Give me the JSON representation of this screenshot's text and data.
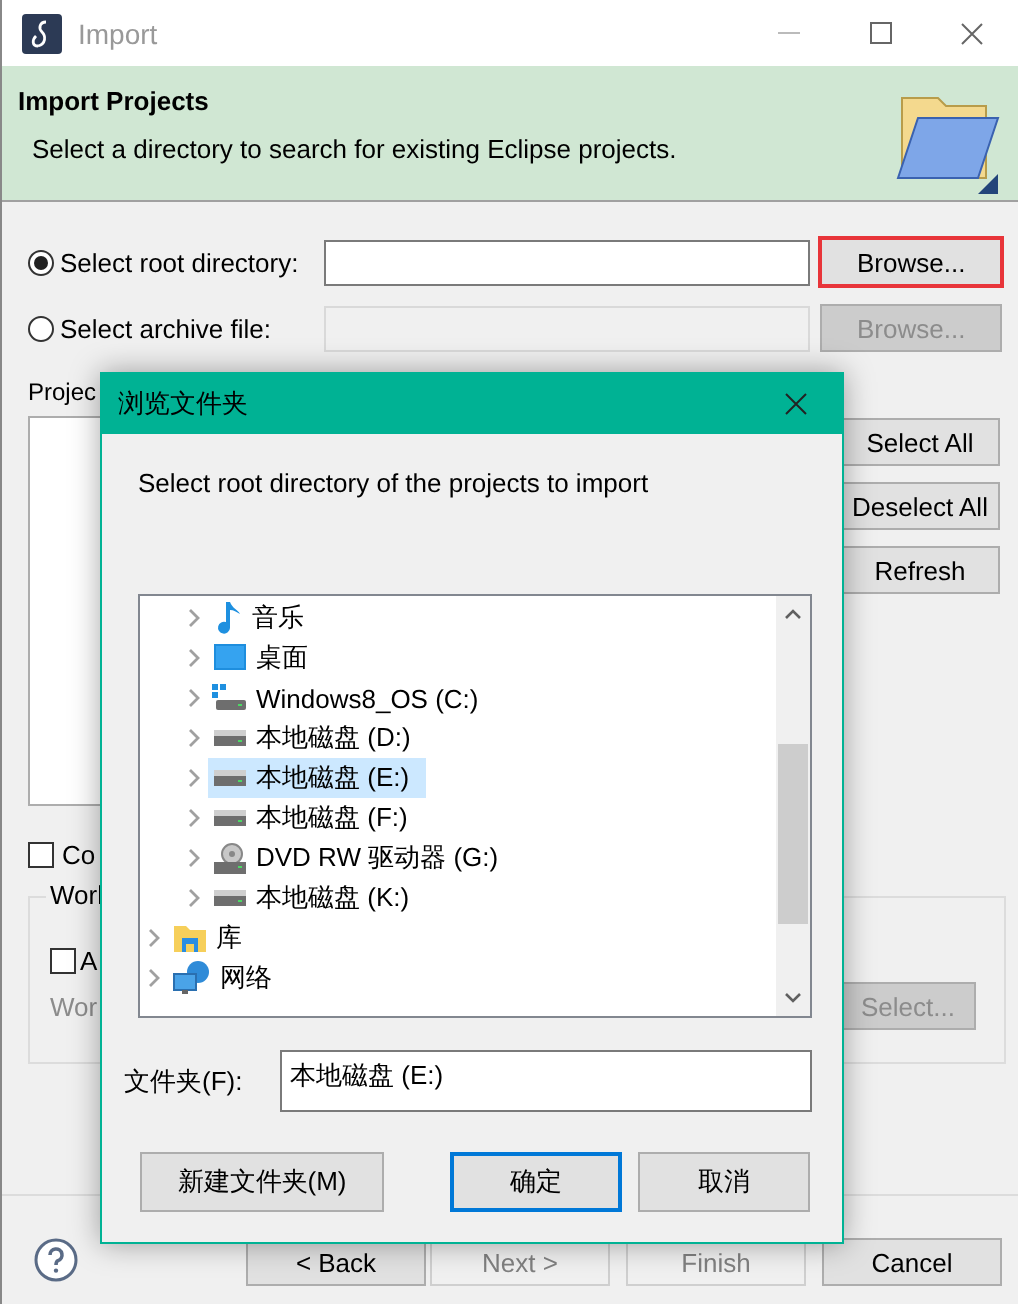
{
  "window": {
    "title": "Import"
  },
  "header": {
    "title": "Import Projects",
    "subtitle": "Select a directory to search for existing Eclipse projects."
  },
  "source": [
    {
      "label": "Select root directory:",
      "selected": true,
      "disabled": false,
      "button": "Browse...",
      "highlighted": true
    },
    {
      "label": "Select archive file:",
      "selected": false,
      "disabled": true,
      "button": "Browse...",
      "highlighted": false
    }
  ],
  "projects": {
    "label": "Projec",
    "buttons": [
      "Select All",
      "Deselect All",
      "Refresh"
    ]
  },
  "options": [
    {
      "label": "Co",
      "checked": false
    }
  ],
  "working_sets": {
    "label": "Worl",
    "checkbox": {
      "label": "A",
      "checked": false
    },
    "field_label": "Wor",
    "field_disabled": true,
    "button": "Select...",
    "button_disabled": true
  },
  "footer": {
    "buttons": [
      {
        "label": "< Back",
        "disabled": false
      },
      {
        "label": "Next >",
        "disabled": true
      },
      {
        "label": "Finish",
        "disabled": true
      },
      {
        "label": "Cancel",
        "disabled": false
      }
    ]
  },
  "folder_dialog": {
    "title": "浏览文件夹",
    "prompt": "Select root directory of the projects to import",
    "tree": {
      "nested_items": [
        {
          "kind": "music",
          "label": "音乐",
          "selected": false
        },
        {
          "kind": "desktop",
          "label": "桌面",
          "selected": false
        },
        {
          "kind": "system-drive",
          "label": "Windows8_OS (C:)",
          "selected": false
        },
        {
          "kind": "drive",
          "label": "本地磁盘 (D:)",
          "selected": false
        },
        {
          "kind": "drive",
          "label": "本地磁盘 (E:)",
          "selected": true
        },
        {
          "kind": "drive",
          "label": "本地磁盘 (F:)",
          "selected": false
        },
        {
          "kind": "dvd",
          "label": "DVD RW 驱动器 (G:)",
          "selected": false
        },
        {
          "kind": "drive",
          "label": "本地磁盘 (K:)",
          "selected": false
        }
      ],
      "items": [
        {
          "kind": "library",
          "label": "库",
          "selected": false
        },
        {
          "kind": "network",
          "label": "网络",
          "selected": false
        }
      ]
    },
    "folder_label": "文件夹(F):",
    "folder_value": "本地磁盘 (E:)",
    "buttons": [
      {
        "label": "新建文件夹(M)",
        "default": false
      },
      {
        "label": "确定",
        "default": true
      },
      {
        "label": "取消",
        "default": false
      }
    ]
  }
}
